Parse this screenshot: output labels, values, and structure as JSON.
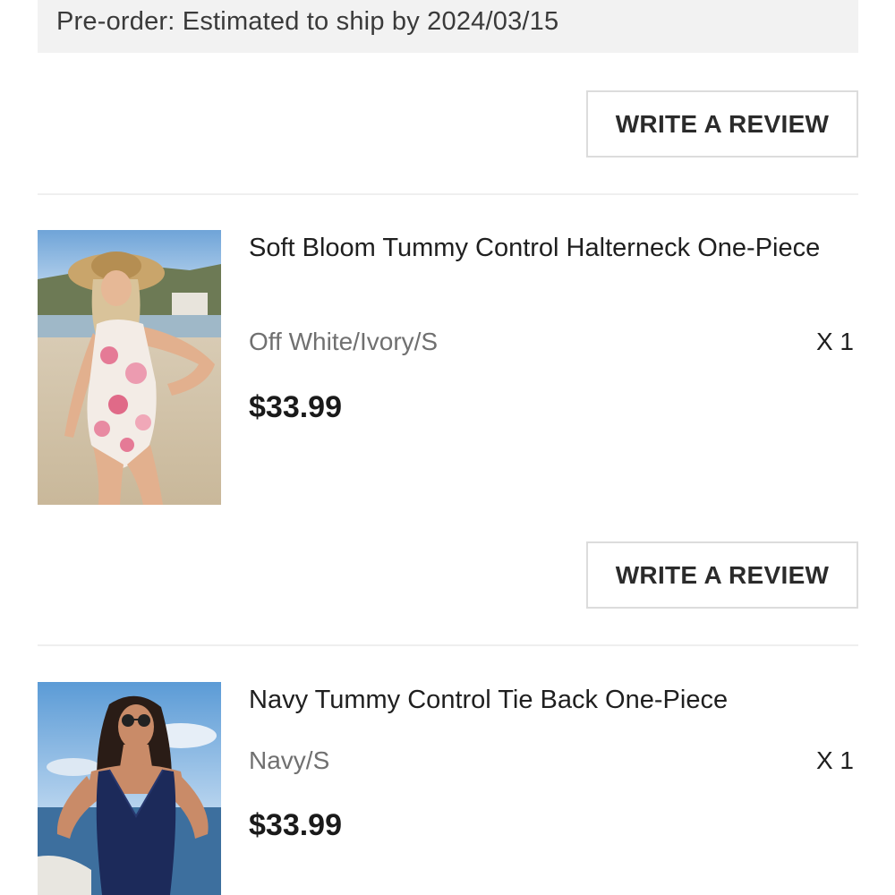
{
  "notice": {
    "text": "Pre-order: Estimated to ship by 2024/03/15"
  },
  "review_button_label": "WRITE A REVIEW",
  "items": [
    {
      "title": "Soft Bloom Tummy Control Halterneck One-Piece",
      "variant": "Off White/Ivory/S",
      "quantity": "X 1",
      "price": "$33.99",
      "image": "floral-one-piece-swimsuit-photo"
    },
    {
      "title": "Navy Tummy Control Tie Back One-Piece",
      "variant": "Navy/S",
      "quantity": "X 1",
      "price": "$33.99",
      "image": "navy-one-piece-swimsuit-photo"
    }
  ],
  "colors": {
    "notice_bg": "#f2f2f2",
    "button_border": "#dcdcdc",
    "variant_text": "#707070",
    "navy": "#1c2a5a"
  }
}
